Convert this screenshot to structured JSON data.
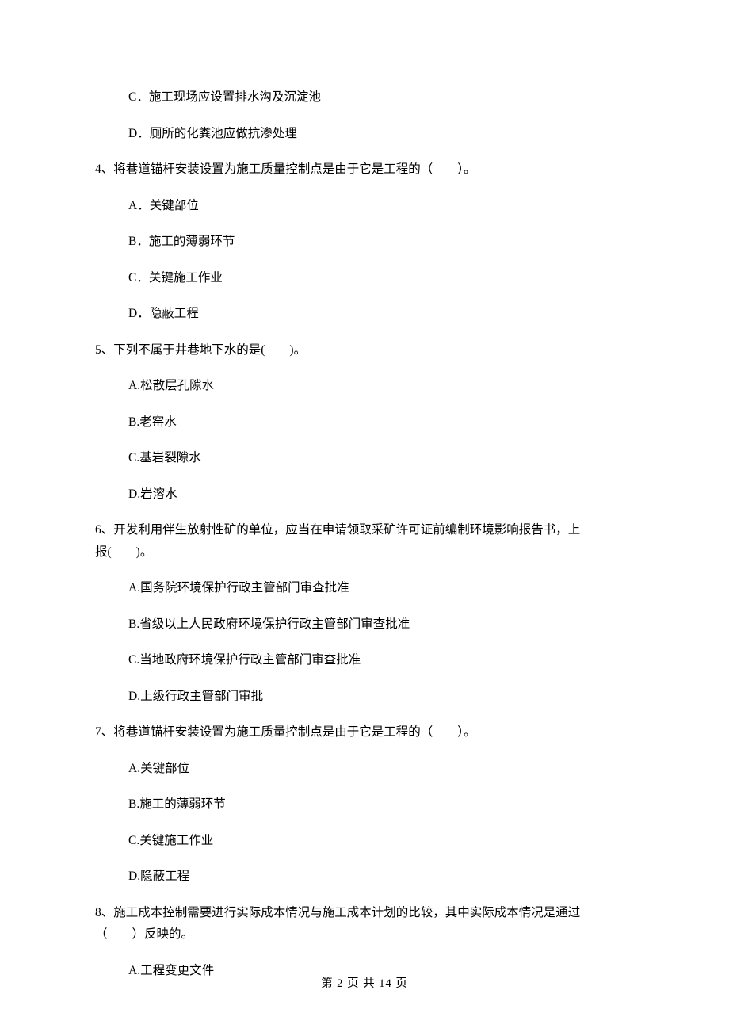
{
  "q3": {
    "optC": "C．施工现场应设置排水沟及沉淀池",
    "optD": "D．厕所的化粪池应做抗渗处理"
  },
  "q4": {
    "stem": "4、将巷道锚杆安装设置为施工质量控制点是由于它是工程的（　　）。",
    "optA": "A．关键部位",
    "optB": "B．施工的薄弱环节",
    "optC": "C．关键施工作业",
    "optD": "D．隐蔽工程"
  },
  "q5": {
    "stem": "5、下列不属于井巷地下水的是(　　)。",
    "optA": "A.松散层孔隙水",
    "optB": "B.老窑水",
    "optC": "C.基岩裂隙水",
    "optD": "D.岩溶水"
  },
  "q6": {
    "stem1": "6、开发利用伴生放射性矿的单位，应当在申请领取采矿许可证前编制环境影响报告书，上",
    "stem2": "报(　　)。",
    "optA": "A.国务院环境保护行政主管部门审查批准",
    "optB": "B.省级以上人民政府环境保护行政主管部门审查批准",
    "optC": "C.当地政府环境保护行政主管部门审查批准",
    "optD": "D.上级行政主管部门审批"
  },
  "q7": {
    "stem": "7、将巷道锚杆安装设置为施工质量控制点是由于它是工程的（　　）。",
    "optA": "A.关键部位",
    "optB": "B.施工的薄弱环节",
    "optC": "C.关键施工作业",
    "optD": "D.隐蔽工程"
  },
  "q8": {
    "stem1": "8、施工成本控制需要进行实际成本情况与施工成本计划的比较，其中实际成本情况是通过",
    "stem2": "（　　）反映的。",
    "optA": "A.工程变更文件"
  },
  "footer": "第 2 页 共 14 页"
}
